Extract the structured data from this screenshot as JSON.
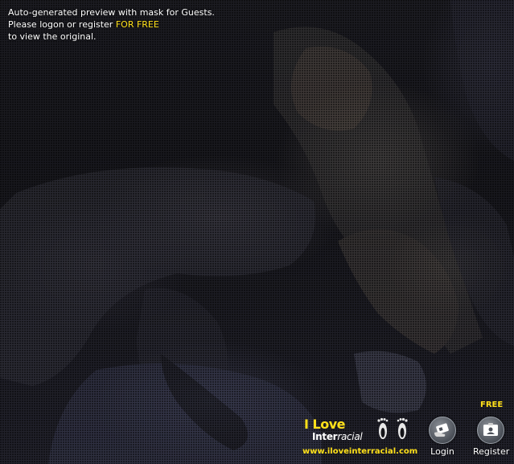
{
  "notice": {
    "line1": "Auto-generated preview with mask for Guests.",
    "line2_prefix": "Please logon or register ",
    "line2_highlight": "FOR FREE",
    "line3": "to view the original."
  },
  "brand": {
    "title_top": "I Love",
    "title_inter": "Inter",
    "title_racial": "racial",
    "url": "www.iloveinterracial.com"
  },
  "actions": {
    "free_badge": "FREE",
    "login_label": "Login",
    "register_label": "Register"
  },
  "colors": {
    "highlight": "#ffe01a",
    "text": "#ffffff",
    "background": "#18181d"
  },
  "icons": {
    "login": "id-card-hand-icon",
    "register": "id-card-icon",
    "brand": "footprints-icon"
  }
}
